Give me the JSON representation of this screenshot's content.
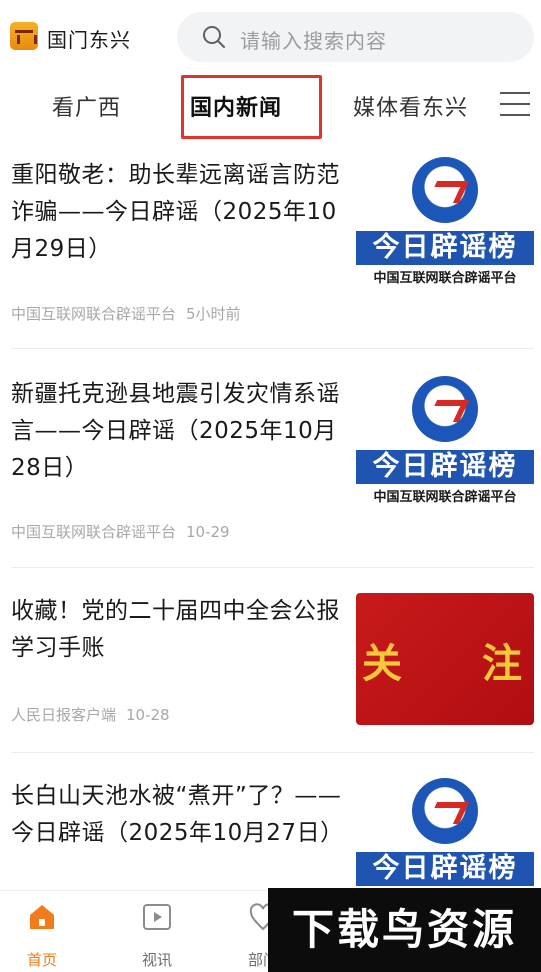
{
  "header": {
    "app_name": "国门东兴",
    "search_placeholder": "请输入搜索内容",
    "brand_color": "#f0a020"
  },
  "tabs": [
    {
      "label": "看广西",
      "active": false
    },
    {
      "label": "国内新闻",
      "active": true
    },
    {
      "label": "媒体看东兴",
      "active": false
    }
  ],
  "news": [
    {
      "title": "重阳敬老：助长辈远离谣言防范诈骗——今日辟谣（2025年10月29日）",
      "source": "中国互联网联合辟谣平台",
      "time": "5小时前",
      "thumb_banner": "今日辟谣榜",
      "thumb_caption": "中国互联网联合辟谣平台"
    },
    {
      "title": "新疆托克逊县地震引发灾情系谣言——今日辟谣（2025年10月28日）",
      "source": "中国互联网联合辟谣平台",
      "time": "10-29",
      "thumb_banner": "今日辟谣榜",
      "thumb_caption": "中国互联网联合辟谣平台"
    },
    {
      "title": "收藏！党的二十届四中全会公报学习手账",
      "source": "人民日报客户端",
      "time": "10-28",
      "thumb_word_left": "关",
      "thumb_word_right": "注"
    },
    {
      "title": "长白山天池水被“煮开”了？——今日辟谣（2025年10月27日）",
      "thumb_banner": "今日辟谣榜"
    }
  ],
  "bottom_nav": [
    {
      "label": "首页",
      "icon": "home-icon",
      "active": true
    },
    {
      "label": "视讯",
      "icon": "video-icon",
      "active": false
    },
    {
      "label": "部门",
      "icon": "department-icon",
      "active": false
    }
  ],
  "watermark": "下载鸟资源",
  "colors": {
    "accent": "#f07d1a",
    "highlight_border": "#e0342a",
    "rumor_blue": "#1f54b0",
    "red_card": "#c81a1a"
  }
}
